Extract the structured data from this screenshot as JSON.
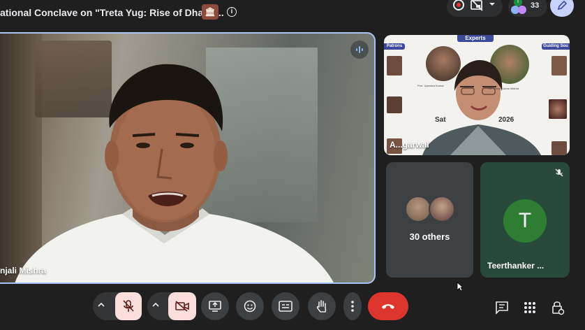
{
  "meeting": {
    "title": "ational Conclave on \"Treta Yug: Rise of Dharm...",
    "badge": "🏛",
    "info_glyph": "i"
  },
  "top_right": {
    "participant_count": "33",
    "avatar_letter": "T"
  },
  "main_tile": {
    "name": "njali Mishra"
  },
  "experts_tile": {
    "header": "Experts",
    "patrons": "Patrons",
    "guiding": "Guiding Sou",
    "sat_text": "Sat",
    "year_text": "2026",
    "name": "A...garwal"
  },
  "others_tile": {
    "label": "30 others"
  },
  "teer_tile": {
    "initial": "T",
    "name": "Teerthanker ..."
  },
  "colors": {
    "accent_blue": "#aac2f0",
    "hangup_red": "#dc362e",
    "off_pink": "#f9dedc",
    "avatar_green": "#2e7d32"
  },
  "toolbar": {
    "icons": [
      "mic-off-icon",
      "camera-off-icon",
      "present-icon",
      "emoji-icon",
      "captions-icon",
      "raise-hand-icon",
      "more-icon",
      "hangup-icon",
      "chat-icon",
      "activities-icon",
      "host-controls-icon"
    ]
  }
}
